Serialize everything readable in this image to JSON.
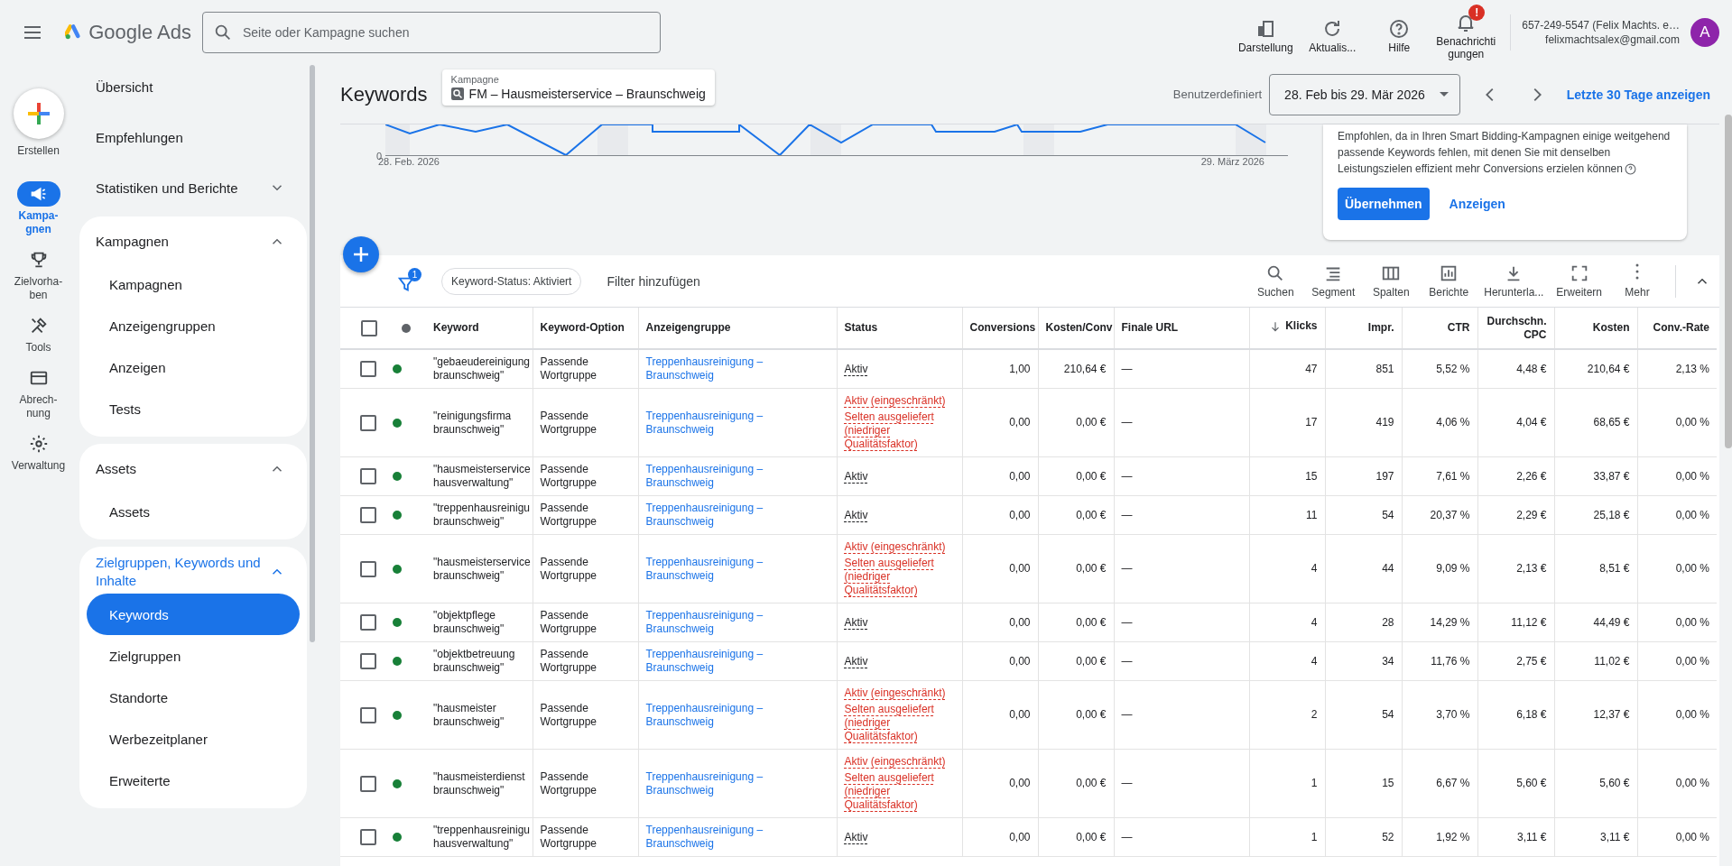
{
  "topbar": {
    "product": "Google Ads",
    "search": {
      "placeholder": "Seite oder Kampagne suchen"
    },
    "actions": [
      {
        "label": "Darstellung"
      },
      {
        "label": "Aktualis..."
      },
      {
        "label": "Hilfe"
      },
      {
        "label": "Benachrichtigungen",
        "badge": "!"
      }
    ],
    "account": {
      "line1": "657-249-5547 (Felix Machts. e…",
      "line2": "felixmachtsalex@gmail.com",
      "avatar": "A"
    }
  },
  "create": {
    "label": "Erstellen"
  },
  "rail": [
    {
      "kind": "nav",
      "label": "Kampa-gnen",
      "selected": true
    },
    {
      "kind": "nav",
      "label": "Zielvorha-ben",
      "selected": false
    },
    {
      "kind": "nav",
      "label": "Tools",
      "selected": false
    },
    {
      "kind": "nav",
      "label": "Abrech-nung",
      "selected": false
    },
    {
      "kind": "nav",
      "label": "Verwaltung",
      "selected": false
    }
  ],
  "sidebar": [
    {
      "kind": "item",
      "label": "Übersicht"
    },
    {
      "kind": "item",
      "label": "Empfehlungen"
    },
    {
      "kind": "group",
      "label": "Statistiken und Berichte",
      "expanded": false
    },
    {
      "kind": "card",
      "label": "Kampagnen",
      "expanded": true,
      "children": [
        {
          "label": "Kampagnen",
          "selected": false
        },
        {
          "label": "Anzeigengruppen",
          "selected": false
        },
        {
          "label": "Anzeigen",
          "selected": false
        },
        {
          "label": "Tests",
          "selected": false
        }
      ]
    },
    {
      "kind": "card",
      "label": "Assets",
      "expanded": true,
      "children": [
        {
          "label": "Assets",
          "selected": false
        }
      ]
    },
    {
      "kind": "card",
      "label": "Zielgruppen, Keywords und Inhalte",
      "expanded": true,
      "children": [
        {
          "label": "Keywords",
          "selected": true
        },
        {
          "label": "Zielgruppen",
          "selected": false
        },
        {
          "label": "Standorte",
          "selected": false
        },
        {
          "label": "Werbezeitplaner",
          "selected": false
        },
        {
          "label": "Erweiterte",
          "selected": false
        }
      ]
    }
  ],
  "header": {
    "title": "Keywords",
    "campaign_label": "Kampagne",
    "campaign": "FM – Hausmeisterservice – Braunschweig",
    "range_label": "Benutzerdefiniert",
    "date_range": "28. Feb bis 29. Mär 2026",
    "link": "Letzte 30 Tage anzeigen"
  },
  "chart": {
    "y_tick": "0",
    "x_labels": [
      "28. Feb. 2026",
      "29. März 2026"
    ]
  },
  "recommendation": {
    "text": "Empfohlen, da in Ihren Smart Bidding-Kampagnen einige weitgehend passende Keywords fehlen, mit denen Sie mit denselben Leistungszielen effizient mehr Conversions erzielen können",
    "apply": "Übernehmen",
    "view": "Anzeigen"
  },
  "toolbar": {
    "filter_count": "1",
    "chip": "Keyword-Status: Aktiviert",
    "add_filter": "Filter hinzufügen",
    "tools": [
      "Suchen",
      "Segment",
      "Spalten",
      "Berichte",
      "Herunterla...",
      "Erweitern",
      "Mehr"
    ]
  },
  "table": {
    "header_checked": false,
    "columns": [
      {
        "label": "Keyword",
        "sorted": false
      },
      {
        "label": "Keyword-Option",
        "sorted": false
      },
      {
        "label": "Anzeigengruppe",
        "sorted": false
      },
      {
        "label": "Status",
        "sorted": false
      },
      {
        "label": "Conversions",
        "sorted": false
      },
      {
        "label": "Kosten/Conv",
        "sorted": false
      },
      {
        "label": "Finale URL",
        "sorted": false
      },
      {
        "label": "Klicks",
        "sorted": true
      },
      {
        "label": "Impr.",
        "sorted": false
      },
      {
        "label": "CTR",
        "sorted": false
      },
      {
        "label": "Durchschn. CPC",
        "sorted": false
      },
      {
        "label": "Kosten",
        "sorted": false
      },
      {
        "label": "Conv.-Rate",
        "sorted": false
      }
    ],
    "rows": [
      {
        "checked": false,
        "color": "#188038",
        "keyword": "\"gebaeudereinigung braunschweig\"",
        "match": "Passende Wortgruppe",
        "ad_group": "Treppenhausreinigung – Braunschweig",
        "status": {
          "kind": "active",
          "lines": [
            "Aktiv"
          ]
        },
        "values": [
          "1,00",
          "210,64 €",
          "—",
          "47",
          "851",
          "5,52 %",
          "4,48 €",
          "210,64 €",
          "2,13 %"
        ]
      },
      {
        "checked": false,
        "color": "#188038",
        "keyword": "\"reinigungsfirma braunschweig\"",
        "match": "Passende Wortgruppe",
        "ad_group": "Treppenhausreinigung – Braunschweig",
        "status": {
          "kind": "limited",
          "lines": [
            "Aktiv (eingeschränkt)",
            "Selten ausgeliefert (niedriger Qualitätsfaktor)"
          ]
        },
        "values": [
          "0,00",
          "0,00 €",
          "—",
          "17",
          "419",
          "4,06 %",
          "4,04 €",
          "68,65 €",
          "0,00 %"
        ]
      },
      {
        "checked": false,
        "color": "#188038",
        "keyword": "\"hausmeisterservice hausverwaltung\"",
        "match": "Passende Wortgruppe",
        "ad_group": "Treppenhausreinigung – Braunschweig",
        "status": {
          "kind": "active",
          "lines": [
            "Aktiv"
          ]
        },
        "values": [
          "0,00",
          "0,00 €",
          "—",
          "15",
          "197",
          "7,61 %",
          "2,26 €",
          "33,87 €",
          "0,00 %"
        ]
      },
      {
        "checked": false,
        "color": "#188038",
        "keyword": "\"treppenhausreinigu braunschweig\"",
        "match": "Passende Wortgruppe",
        "ad_group": "Treppenhausreinigung – Braunschweig",
        "status": {
          "kind": "active",
          "lines": [
            "Aktiv"
          ]
        },
        "values": [
          "0,00",
          "0,00 €",
          "—",
          "11",
          "54",
          "20,37 %",
          "2,29 €",
          "25,18 €",
          "0,00 %"
        ]
      },
      {
        "checked": false,
        "color": "#188038",
        "keyword": "\"hausmeisterservice braunschweig\"",
        "match": "Passende Wortgruppe",
        "ad_group": "Treppenhausreinigung – Braunschweig",
        "status": {
          "kind": "limited",
          "lines": [
            "Aktiv (eingeschränkt)",
            "Selten ausgeliefert (niedriger Qualitätsfaktor)"
          ]
        },
        "values": [
          "0,00",
          "0,00 €",
          "—",
          "4",
          "44",
          "9,09 %",
          "2,13 €",
          "8,51 €",
          "0,00 %"
        ]
      },
      {
        "checked": false,
        "color": "#188038",
        "keyword": "\"objektpflege braunschweig\"",
        "match": "Passende Wortgruppe",
        "ad_group": "Treppenhausreinigung – Braunschweig",
        "status": {
          "kind": "active",
          "lines": [
            "Aktiv"
          ]
        },
        "values": [
          "0,00",
          "0,00 €",
          "—",
          "4",
          "28",
          "14,29 %",
          "11,12 €",
          "44,49 €",
          "0,00 %"
        ]
      },
      {
        "checked": false,
        "color": "#188038",
        "keyword": "\"objektbetreuung braunschweig\"",
        "match": "Passende Wortgruppe",
        "ad_group": "Treppenhausreinigung – Braunschweig",
        "status": {
          "kind": "active",
          "lines": [
            "Aktiv"
          ]
        },
        "values": [
          "0,00",
          "0,00 €",
          "—",
          "4",
          "34",
          "11,76 %",
          "2,75 €",
          "11,02 €",
          "0,00 %"
        ]
      },
      {
        "checked": false,
        "color": "#188038",
        "keyword": "\"hausmeister braunschweig\"",
        "match": "Passende Wortgruppe",
        "ad_group": "Treppenhausreinigung – Braunschweig",
        "status": {
          "kind": "limited",
          "lines": [
            "Aktiv (eingeschränkt)",
            "Selten ausgeliefert (niedriger Qualitätsfaktor)"
          ]
        },
        "values": [
          "0,00",
          "0,00 €",
          "—",
          "2",
          "54",
          "3,70 %",
          "6,18 €",
          "12,37 €",
          "0,00 %"
        ]
      },
      {
        "checked": false,
        "color": "#188038",
        "keyword": "\"hausmeisterdienst braunschweig\"",
        "match": "Passende Wortgruppe",
        "ad_group": "Treppenhausreinigung – Braunschweig",
        "status": {
          "kind": "limited",
          "lines": [
            "Aktiv (eingeschränkt)",
            "Selten ausgeliefert (niedriger Qualitätsfaktor)"
          ]
        },
        "values": [
          "0,00",
          "0,00 €",
          "—",
          "1",
          "15",
          "6,67 %",
          "5,60 €",
          "5,60 €",
          "0,00 %"
        ]
      },
      {
        "checked": false,
        "color": "#188038",
        "keyword": "\"treppenhausreinigu hausverwaltung\"",
        "match": "Passende Wortgruppe",
        "ad_group": "Treppenhausreinigung – Braunschweig",
        "status": {
          "kind": "active",
          "lines": [
            "Aktiv"
          ]
        },
        "values": [
          "0,00",
          "0,00 €",
          "—",
          "1",
          "52",
          "1,92 %",
          "3,11 €",
          "3,11 €",
          "0,00 %"
        ]
      }
    ]
  }
}
